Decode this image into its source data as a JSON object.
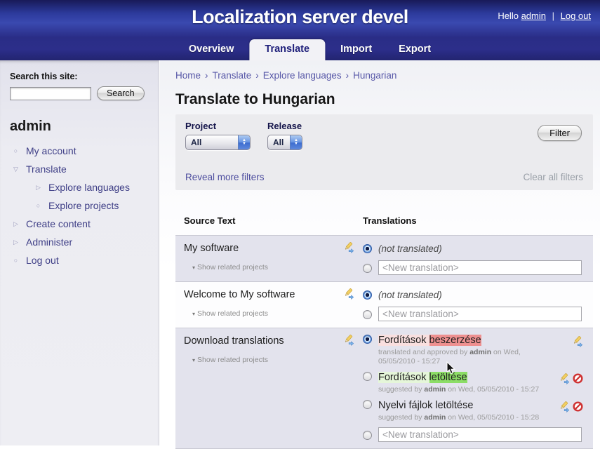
{
  "header": {
    "title": "Localization server devel",
    "greeting": "Hello",
    "user": "admin",
    "separator": "|",
    "logout": "Log out",
    "tabs": [
      {
        "label": "Overview",
        "active": false
      },
      {
        "label": "Translate",
        "active": true
      },
      {
        "label": "Import",
        "active": false
      },
      {
        "label": "Export",
        "active": false
      }
    ]
  },
  "sidebar": {
    "search_label": "Search this site:",
    "search_value": "",
    "search_button": "Search",
    "user_heading": "admin",
    "menu": [
      {
        "label": "My account",
        "bullet": "circle",
        "level": 0
      },
      {
        "label": "Translate",
        "bullet": "open-down",
        "level": 0
      },
      {
        "label": "Explore languages",
        "bullet": "open-right",
        "level": 1
      },
      {
        "label": "Explore projects",
        "bullet": "circle",
        "level": 1
      },
      {
        "label": "Create content",
        "bullet": "open-right",
        "level": 0
      },
      {
        "label": "Administer",
        "bullet": "open-right",
        "level": 0
      },
      {
        "label": "Log out",
        "bullet": "circle",
        "level": 0
      }
    ]
  },
  "main": {
    "breadcrumb": [
      "Home",
      "Translate",
      "Explore languages",
      "Hungarian"
    ],
    "breadcrumb_separator": "›",
    "page_title": "Translate to Hungarian",
    "filters": {
      "project_label": "Project",
      "project_value": "All",
      "release_label": "Release",
      "release_value": "All",
      "filter_button": "Filter",
      "reveal_link": "Reveal more filters",
      "clear_link": "Clear all filters"
    },
    "table": {
      "col_source": "Source Text",
      "col_translations": "Translations",
      "rows": [
        {
          "source": "My software",
          "toggle": "Show related projects",
          "translations": [
            {
              "type": "label",
              "selected": true,
              "text": "(not translated)"
            },
            {
              "type": "input",
              "selected": false,
              "value": "<New translation>"
            }
          ]
        },
        {
          "source": "Welcome to My software",
          "toggle": "Show related projects",
          "translations": [
            {
              "type": "label",
              "selected": true,
              "text": "(not translated)"
            },
            {
              "type": "input",
              "selected": false,
              "value": "<New translation>"
            }
          ]
        },
        {
          "source": "Download translations",
          "toggle": "Show related projects",
          "translations": [
            {
              "type": "suggestion",
              "selected": true,
              "tint": "red",
              "segments": [
                {
                  "text": "Fordítások ",
                  "emphasis": false
                },
                {
                  "text": "beszerzése",
                  "emphasis": true
                }
              ],
              "meta_prefix": "translated and approved by",
              "meta_user": "admin",
              "meta_date": "on Wed, 05/05/2010 - 15:27",
              "icons": [
                "edit"
              ]
            },
            {
              "type": "suggestion",
              "selected": false,
              "tint": "green",
              "segments": [
                {
                  "text": "Fordítások ",
                  "emphasis": false
                },
                {
                  "text": "letöltése",
                  "emphasis": true
                }
              ],
              "meta_prefix": "suggested by",
              "meta_user": "admin",
              "meta_date": "on Wed, 05/05/2010 - 15:27",
              "icons": [
                "edit",
                "decline"
              ]
            },
            {
              "type": "suggestion",
              "selected": false,
              "tint": "none",
              "segments": [
                {
                  "text": "Nyelvi fájlok letöltése",
                  "emphasis": false
                }
              ],
              "meta_prefix": "suggested by",
              "meta_user": "admin",
              "meta_date": "on Wed, 05/05/2010 - 15:28",
              "icons": [
                "edit",
                "decline"
              ]
            },
            {
              "type": "input",
              "selected": false,
              "value": "<New translation>"
            }
          ]
        }
      ]
    }
  },
  "colors": {
    "header_blue": "#3a49b0",
    "header_navy": "#222470",
    "active_tab_bg": "#f2f2f6",
    "link": "#4c4c9e",
    "row_alt": "#e3e3ed",
    "highlight_red_strong": "#ee9090",
    "highlight_red_light": "#f9dfdf",
    "highlight_green_strong": "#8cdd66",
    "highlight_green_light": "#e5f6d9",
    "decline_red": "#cf3333",
    "pencil_yellow": "#f2cf63"
  }
}
